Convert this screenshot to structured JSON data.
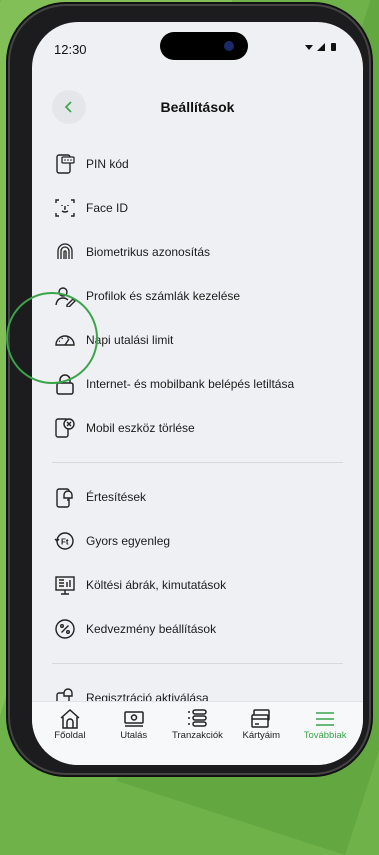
{
  "status": {
    "time": "12:30"
  },
  "header": {
    "title": "Beállítások"
  },
  "menu": {
    "group1": [
      {
        "label": "PIN kód",
        "icon": "pin-phone-icon"
      },
      {
        "label": "Face ID",
        "icon": "face-id-icon"
      },
      {
        "label": "Biometrikus azonosítás",
        "icon": "fingerprint-icon"
      },
      {
        "label": "Profilok és számlák kezelése",
        "icon": "user-edit-icon"
      },
      {
        "label": "Napi utalási limit",
        "icon": "speedometer-icon"
      },
      {
        "label": "Internet- és mobilbank belépés letiltása",
        "icon": "lock-icon"
      },
      {
        "label": "Mobil eszköz törlése",
        "icon": "phone-delete-icon"
      }
    ],
    "group2": [
      {
        "label": "Értesítések",
        "icon": "notification-phone-icon"
      },
      {
        "label": "Gyors egyenleg",
        "icon": "quick-balance-icon"
      },
      {
        "label": "Költési ábrák, kimutatások",
        "icon": "chart-board-icon"
      },
      {
        "label": "Kedvezmény beállítások",
        "icon": "percent-icon"
      }
    ],
    "group3": [
      {
        "label": "Regisztráció aktiválása",
        "icon": "registration-icon"
      }
    ]
  },
  "tabbar": {
    "home": "Főoldal",
    "transfer": "Utalás",
    "transactions": "Tranzakciók",
    "cards": "Kártyáim",
    "more": "Továbbiak"
  },
  "colors": {
    "accent": "#3aa44a",
    "background": "#eff0f4"
  }
}
